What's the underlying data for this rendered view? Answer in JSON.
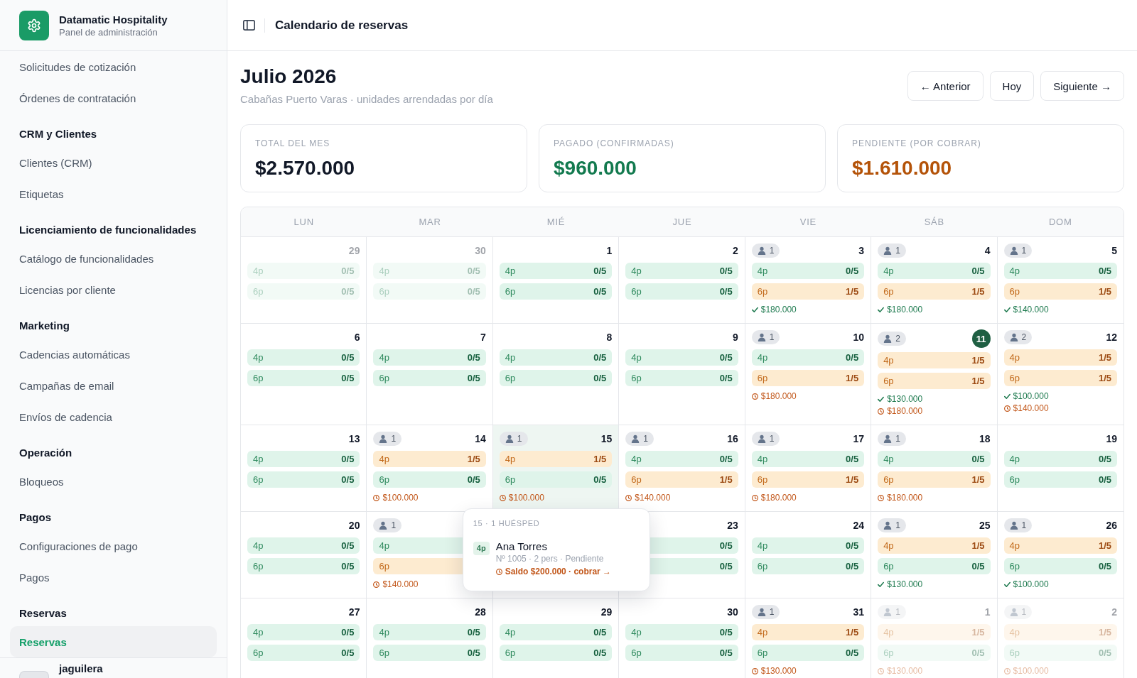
{
  "sidebar": {
    "brand": {
      "name": "Datamatic Hospitality",
      "subtitle": "Panel de administración"
    },
    "groups": [
      {
        "items": [
          {
            "label": "Solicitudes de cotización",
            "selected": false
          },
          {
            "label": "Órdenes de contratación",
            "selected": false
          }
        ]
      },
      {
        "title": "CRM y Clientes",
        "items": [
          {
            "label": "Clientes (CRM)",
            "selected": false
          },
          {
            "label": "Etiquetas",
            "selected": false
          }
        ]
      },
      {
        "title": "Licenciamiento de funcionalidades",
        "items": [
          {
            "label": "Catálogo de funcionalidades",
            "selected": false
          },
          {
            "label": "Licencias por cliente",
            "selected": false
          }
        ]
      },
      {
        "title": "Marketing",
        "items": [
          {
            "label": "Cadencias automáticas",
            "selected": false
          },
          {
            "label": "Campañas de email",
            "selected": false
          },
          {
            "label": "Envíos de cadencia",
            "selected": false
          }
        ]
      },
      {
        "title": "Operación",
        "items": [
          {
            "label": "Bloqueos",
            "selected": false
          }
        ]
      },
      {
        "title": "Pagos",
        "items": [
          {
            "label": "Configuraciones de pago",
            "selected": false
          },
          {
            "label": "Pagos",
            "selected": false
          }
        ]
      },
      {
        "title": "Reservas",
        "items": [
          {
            "label": "Reservas",
            "selected": true
          }
        ]
      }
    ],
    "user": {
      "name": "jaguilera"
    }
  },
  "topbar": {
    "title": "Calendario de reservas"
  },
  "header": {
    "title": "Julio 2026",
    "subtitle": "Cabañas Puerto Varas · unidades arrendadas por día",
    "buttons": [
      "← Anterior",
      "Hoy",
      "Siguiente →"
    ]
  },
  "summary": [
    {
      "label": "TOTAL DEL MES",
      "value": "$2.570.000",
      "kind": "total"
    },
    {
      "label": "PAGADO (CONFIRMADAS)",
      "value": "$960.000",
      "kind": "paid"
    },
    {
      "label": "PENDIENTE (POR COBRAR)",
      "value": "$1.610.000",
      "kind": "pending"
    }
  ],
  "calendar": {
    "weekdays": [
      "LUN",
      "MAR",
      "MIÉ",
      "JUE",
      "VIE",
      "SÁB",
      "DOM"
    ],
    "weeks": [
      [
        {
          "day": "29",
          "outside": true,
          "selected": false,
          "units": [
            {
              "label": "4p",
              "count": "0/5",
              "booked": false
            },
            {
              "label": "6p",
              "count": "0/5",
              "booked": false
            }
          ]
        },
        {
          "day": "30",
          "outside": true,
          "selected": false,
          "units": [
            {
              "label": "4p",
              "count": "0/5",
              "booked": false
            },
            {
              "label": "6p",
              "count": "0/5",
              "booked": false
            }
          ]
        },
        {
          "day": "1",
          "outside": false,
          "selected": false,
          "units": [
            {
              "label": "4p",
              "count": "0/5",
              "booked": false
            },
            {
              "label": "6p",
              "count": "0/5",
              "booked": false
            }
          ]
        },
        {
          "day": "2",
          "outside": false,
          "selected": false,
          "units": [
            {
              "label": "4p",
              "count": "0/5",
              "booked": false
            },
            {
              "label": "6p",
              "count": "0/5",
              "booked": false
            }
          ]
        },
        {
          "day": "3",
          "outside": false,
          "selected": false,
          "guests": "1",
          "units": [
            {
              "label": "4p",
              "count": "0/5",
              "booked": false
            },
            {
              "label": "6p",
              "count": "1/5",
              "booked": true
            }
          ],
          "amounts": [
            {
              "kind": "paid",
              "text": "$180.000"
            }
          ]
        },
        {
          "day": "4",
          "outside": false,
          "selected": false,
          "guests": "1",
          "units": [
            {
              "label": "4p",
              "count": "0/5",
              "booked": false
            },
            {
              "label": "6p",
              "count": "1/5",
              "booked": true
            }
          ],
          "amounts": [
            {
              "kind": "paid",
              "text": "$180.000"
            }
          ]
        },
        {
          "day": "5",
          "outside": false,
          "selected": false,
          "guests": "1",
          "units": [
            {
              "label": "4p",
              "count": "0/5",
              "booked": false
            },
            {
              "label": "6p",
              "count": "1/5",
              "booked": true
            }
          ],
          "amounts": [
            {
              "kind": "paid",
              "text": "$140.000"
            }
          ]
        }
      ],
      [
        {
          "day": "6",
          "outside": false,
          "selected": false,
          "units": [
            {
              "label": "4p",
              "count": "0/5",
              "booked": false
            },
            {
              "label": "6p",
              "count": "0/5",
              "booked": false
            }
          ]
        },
        {
          "day": "7",
          "outside": false,
          "selected": false,
          "units": [
            {
              "label": "4p",
              "count": "0/5",
              "booked": false
            },
            {
              "label": "6p",
              "count": "0/5",
              "booked": false
            }
          ]
        },
        {
          "day": "8",
          "outside": false,
          "selected": false,
          "units": [
            {
              "label": "4p",
              "count": "0/5",
              "booked": false
            },
            {
              "label": "6p",
              "count": "0/5",
              "booked": false
            }
          ]
        },
        {
          "day": "9",
          "outside": false,
          "selected": false,
          "units": [
            {
              "label": "4p",
              "count": "0/5",
              "booked": false
            },
            {
              "label": "6p",
              "count": "0/5",
              "booked": false
            }
          ]
        },
        {
          "day": "10",
          "outside": false,
          "selected": false,
          "guests": "1",
          "units": [
            {
              "label": "4p",
              "count": "0/5",
              "booked": false
            },
            {
              "label": "6p",
              "count": "1/5",
              "booked": true
            }
          ],
          "amounts": [
            {
              "kind": "pending",
              "text": "$180.000"
            }
          ]
        },
        {
          "day": "11",
          "outside": false,
          "today": true,
          "selected": false,
          "guests": "2",
          "units": [
            {
              "label": "4p",
              "count": "1/5",
              "booked": true
            },
            {
              "label": "6p",
              "count": "1/5",
              "booked": true
            }
          ],
          "amounts": [
            {
              "kind": "paid",
              "text": "$130.000"
            },
            {
              "kind": "pending",
              "text": "$180.000"
            }
          ]
        },
        {
          "day": "12",
          "outside": false,
          "selected": false,
          "guests": "2",
          "units": [
            {
              "label": "4p",
              "count": "1/5",
              "booked": true
            },
            {
              "label": "6p",
              "count": "1/5",
              "booked": true
            }
          ],
          "amounts": [
            {
              "kind": "paid",
              "text": "$100.000"
            },
            {
              "kind": "pending",
              "text": "$140.000"
            }
          ]
        }
      ],
      [
        {
          "day": "13",
          "outside": false,
          "selected": false,
          "units": [
            {
              "label": "4p",
              "count": "0/5",
              "booked": false
            },
            {
              "label": "6p",
              "count": "0/5",
              "booked": false
            }
          ]
        },
        {
          "day": "14",
          "outside": false,
          "selected": false,
          "guests": "1",
          "units": [
            {
              "label": "4p",
              "count": "1/5",
              "booked": true
            },
            {
              "label": "6p",
              "count": "0/5",
              "booked": false
            }
          ],
          "amounts": [
            {
              "kind": "pending",
              "text": "$100.000"
            }
          ]
        },
        {
          "day": "15",
          "outside": false,
          "selected": true,
          "guests": "1",
          "units": [
            {
              "label": "4p",
              "count": "1/5",
              "booked": true
            },
            {
              "label": "6p",
              "count": "0/5",
              "booked": false
            }
          ],
          "amounts": [
            {
              "kind": "pending",
              "text": "$100.000"
            }
          ]
        },
        {
          "day": "16",
          "outside": false,
          "selected": false,
          "guests": "1",
          "units": [
            {
              "label": "4p",
              "count": "0/5",
              "booked": false
            },
            {
              "label": "6p",
              "count": "1/5",
              "booked": true
            }
          ],
          "amounts": [
            {
              "kind": "pending",
              "text": "$140.000"
            }
          ]
        },
        {
          "day": "17",
          "outside": false,
          "selected": false,
          "guests": "1",
          "units": [
            {
              "label": "4p",
              "count": "0/5",
              "booked": false
            },
            {
              "label": "6p",
              "count": "1/5",
              "booked": true
            }
          ],
          "amounts": [
            {
              "kind": "pending",
              "text": "$180.000"
            }
          ]
        },
        {
          "day": "18",
          "outside": false,
          "selected": false,
          "guests": "1",
          "units": [
            {
              "label": "4p",
              "count": "0/5",
              "booked": false
            },
            {
              "label": "6p",
              "count": "1/5",
              "booked": true
            }
          ],
          "amounts": [
            {
              "kind": "pending",
              "text": "$180.000"
            }
          ]
        },
        {
          "day": "19",
          "outside": false,
          "selected": false,
          "units": [
            {
              "label": "4p",
              "count": "0/5",
              "booked": false
            },
            {
              "label": "6p",
              "count": "0/5",
              "booked": false
            }
          ]
        }
      ],
      [
        {
          "day": "20",
          "outside": false,
          "selected": false,
          "units": [
            {
              "label": "4p",
              "count": "0/5",
              "booked": false
            },
            {
              "label": "6p",
              "count": "0/5",
              "booked": false
            }
          ]
        },
        {
          "outside": false,
          "selected": false,
          "guests": "1",
          "units": [
            {
              "label": "4p",
              "booked": false
            },
            {
              "label": "6p",
              "booked": true
            }
          ],
          "amounts": [
            {
              "kind": "pending",
              "text": "$140.000"
            }
          ]
        },
        {
          "selected": false
        },
        {
          "day": "23",
          "outside": false,
          "selected": false,
          "units": [
            {
              "count": "0/5",
              "booked": false
            },
            {
              "count": "0/5",
              "booked": false
            }
          ]
        },
        {
          "day": "24",
          "outside": false,
          "selected": false,
          "units": [
            {
              "label": "4p",
              "count": "0/5",
              "booked": false
            },
            {
              "label": "6p",
              "count": "0/5",
              "booked": false
            }
          ]
        },
        {
          "day": "25",
          "outside": false,
          "selected": false,
          "guests": "1",
          "units": [
            {
              "label": "4p",
              "count": "1/5",
              "booked": true
            },
            {
              "label": "6p",
              "count": "0/5",
              "booked": false
            }
          ],
          "amounts": [
            {
              "kind": "paid",
              "text": "$130.000"
            }
          ]
        },
        {
          "day": "26",
          "outside": false,
          "selected": false,
          "guests": "1",
          "units": [
            {
              "label": "4p",
              "count": "1/5",
              "booked": true
            },
            {
              "label": "6p",
              "count": "0/5",
              "booked": false
            }
          ],
          "amounts": [
            {
              "kind": "paid",
              "text": "$100.000"
            }
          ]
        }
      ],
      [
        {
          "day": "27",
          "outside": false,
          "selected": false,
          "units": [
            {
              "label": "4p",
              "count": "0/5",
              "booked": false
            },
            {
              "label": "6p",
              "count": "0/5",
              "booked": false
            }
          ]
        },
        {
          "day": "28",
          "outside": false,
          "selected": false,
          "units": [
            {
              "label": "4p",
              "count": "0/5",
              "booked": false
            },
            {
              "label": "6p",
              "count": "0/5",
              "booked": false
            }
          ]
        },
        {
          "day": "29",
          "outside": false,
          "selected": false,
          "units": [
            {
              "label": "4p",
              "count": "0/5",
              "booked": false
            },
            {
              "label": "6p",
              "count": "0/5",
              "booked": false
            }
          ]
        },
        {
          "day": "30",
          "outside": false,
          "selected": false,
          "units": [
            {
              "label": "4p",
              "count": "0/5",
              "booked": false
            },
            {
              "label": "6p",
              "count": "0/5",
              "booked": false
            }
          ]
        },
        {
          "day": "31",
          "outside": false,
          "selected": false,
          "guests": "1",
          "units": [
            {
              "label": "4p",
              "count": "1/5",
              "booked": true
            },
            {
              "label": "6p",
              "count": "0/5",
              "booked": false
            }
          ],
          "amounts": [
            {
              "kind": "pending",
              "text": "$130.000"
            }
          ]
        },
        {
          "day": "1",
          "outside": true,
          "selected": false,
          "guests": "1",
          "units": [
            {
              "label": "4p",
              "count": "1/5",
              "booked": true
            },
            {
              "label": "6p",
              "count": "0/5",
              "booked": false
            }
          ],
          "amounts": [
            {
              "kind": "pending",
              "text": "$130.000"
            }
          ]
        },
        {
          "day": "2",
          "outside": true,
          "selected": false,
          "guests": "1",
          "units": [
            {
              "label": "4p",
              "count": "1/5",
              "booked": true
            },
            {
              "label": "6p",
              "count": "0/5",
              "booked": false
            }
          ],
          "amounts": [
            {
              "kind": "pending",
              "text": "$100.000"
            }
          ]
        }
      ]
    ],
    "popover": {
      "heading": "15 · 1 HUÉSPED",
      "bookings": [
        {
          "unit": "4p",
          "guest": "Ana Torres",
          "details": "Nº 1005 · 2 pers · Pendiente",
          "balance": "Saldo $200.000 · cobrar →"
        }
      ]
    }
  }
}
